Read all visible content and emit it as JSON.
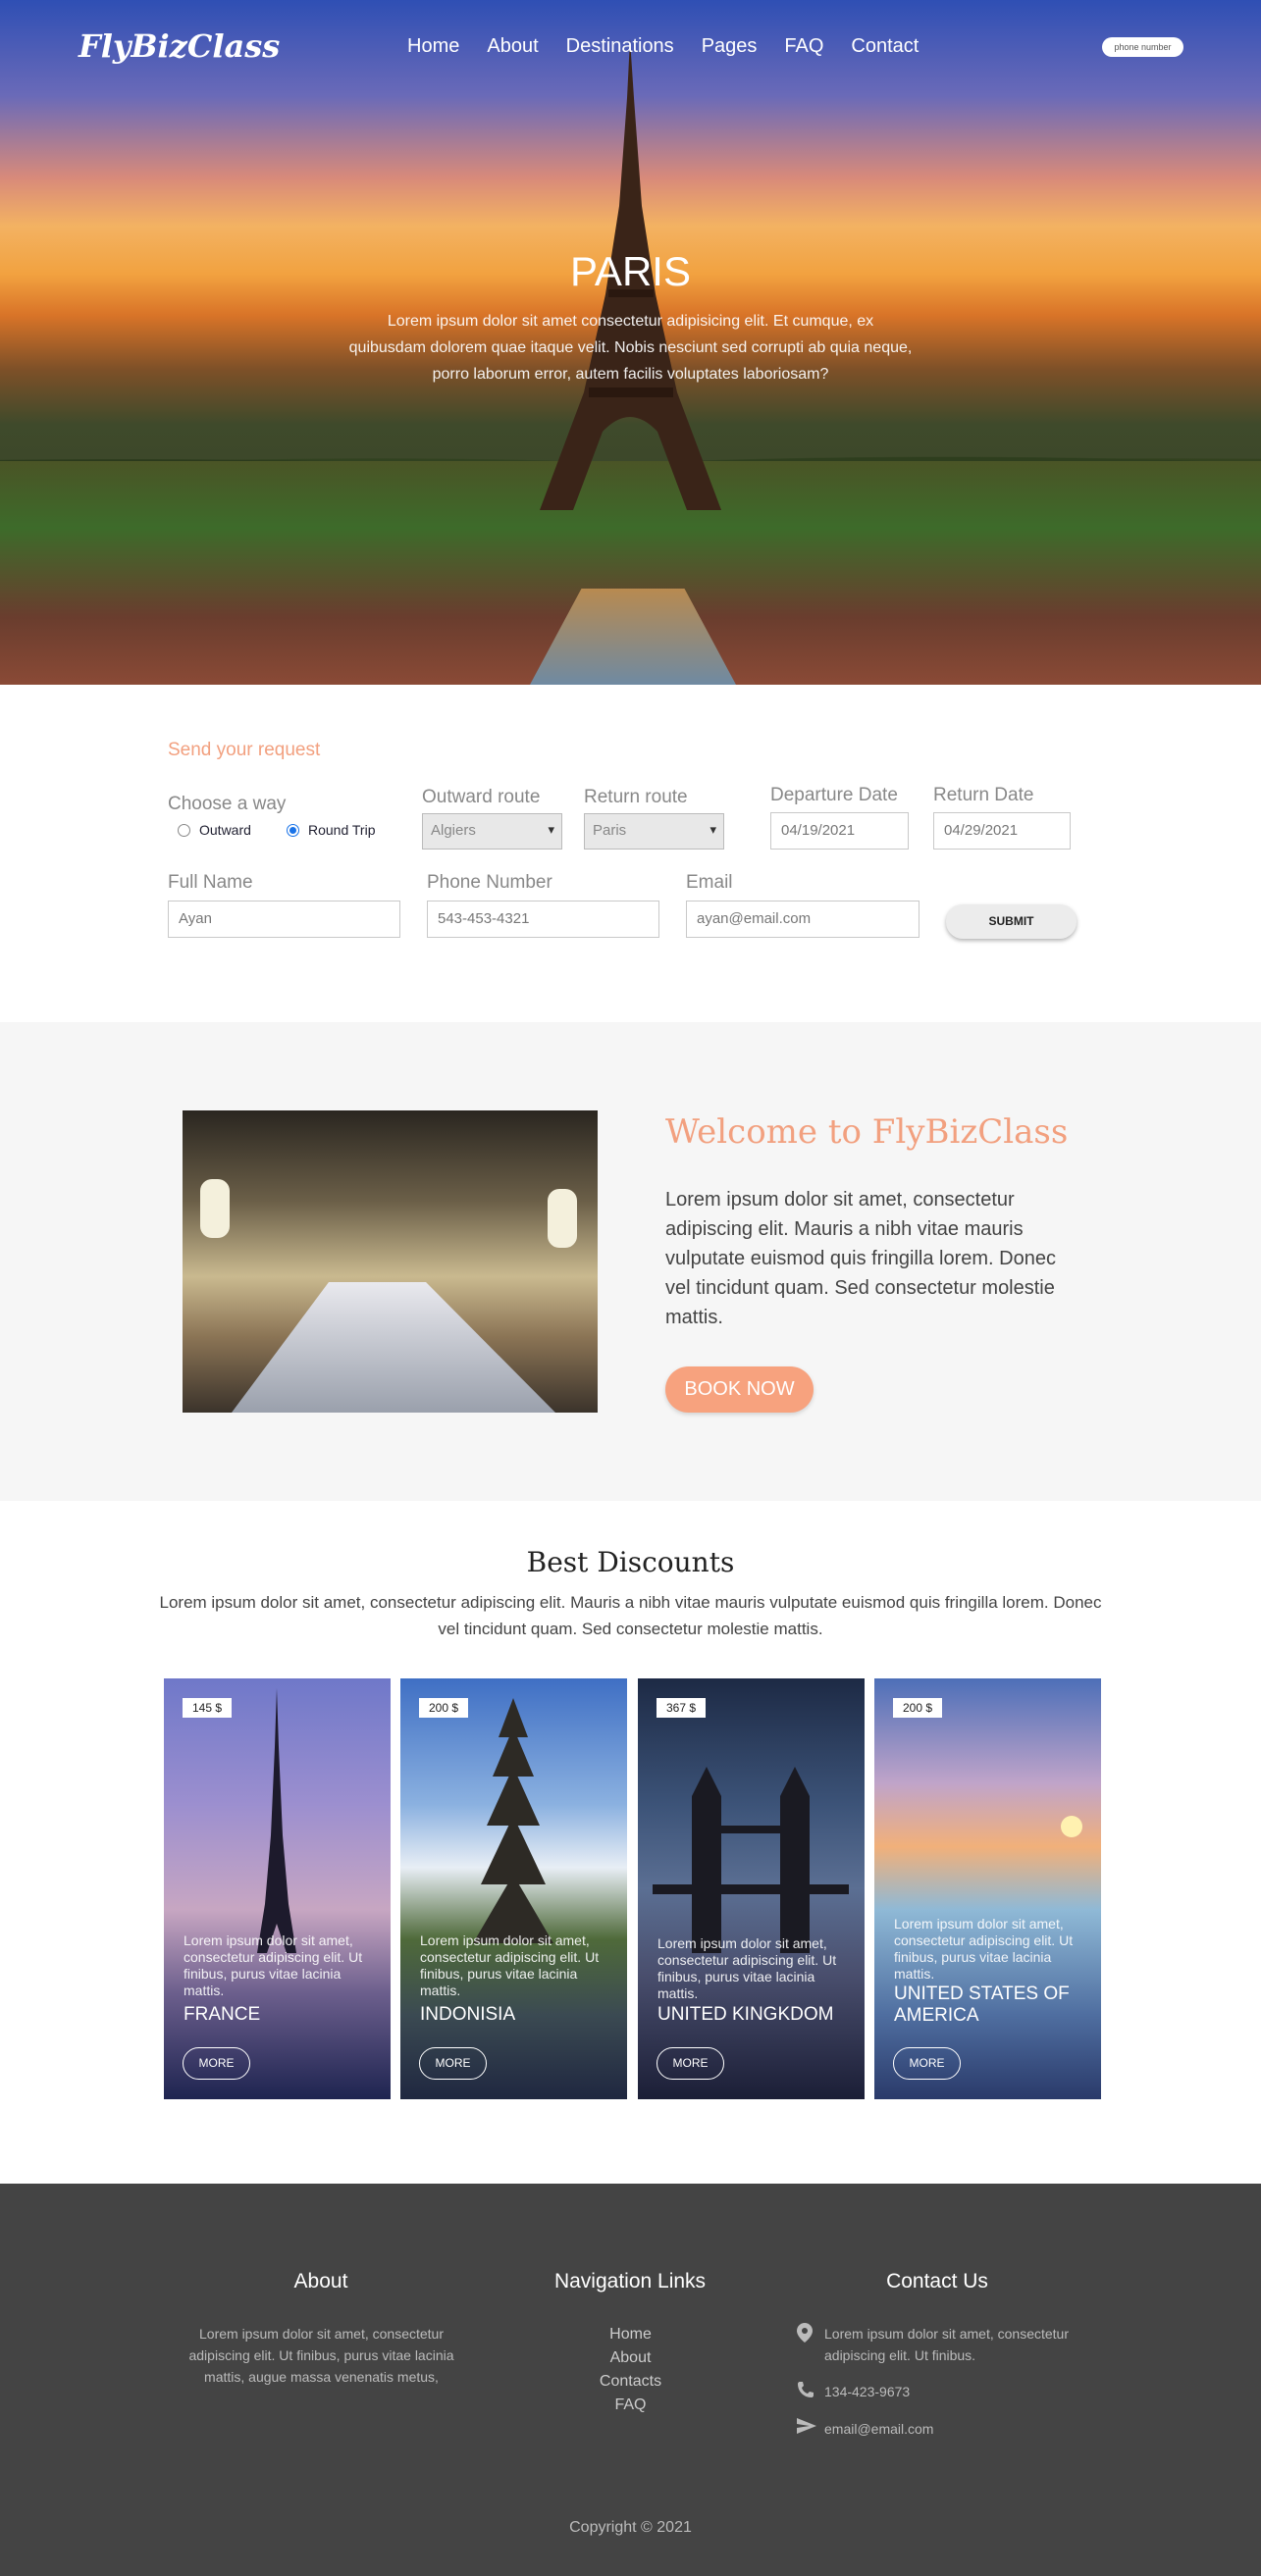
{
  "header": {
    "logo": "FlyBizClass",
    "nav": [
      "Home",
      "About",
      "Destinations",
      "Pages",
      "FAQ",
      "Contact"
    ],
    "phone_label": "phone number"
  },
  "hero": {
    "title": "PARIS",
    "text": "Lorem ipsum dolor sit amet consectetur adipisicing elit. Et cumque, ex quibusdam dolorem quae itaque velit. Nobis nesciunt sed corrupti ab quia neque, porro laborum error, autem facilis voluptates laboriosam?"
  },
  "request_form": {
    "title": "Send your request",
    "choose_way_label": "Choose a way",
    "options": [
      "Outward",
      "Round Trip"
    ],
    "selected_option": "Round Trip",
    "outward_route_label": "Outward route",
    "outward_route_value": "Algiers",
    "return_route_label": "Return route",
    "return_route_value": "Paris",
    "departure_date_label": "Departure Date",
    "departure_date_value": "04/19/2021",
    "return_date_label": "Return Date",
    "return_date_value": "04/29/2021",
    "full_name_label": "Full Name",
    "full_name_value": "Ayan",
    "phone_label": "Phone Number",
    "phone_value": "543-453-4321",
    "email_label": "Email",
    "email_value": "ayan@email.com",
    "submit_label": "SUBMIT"
  },
  "welcome": {
    "title": "Welcome to FlyBizClass",
    "text": "Lorem ipsum dolor sit amet, consectetur adipiscing elit. Mauris a nibh vitae mauris vulputate euismod quis fringilla lorem. Donec vel tincidunt quam. Sed consectetur molestie mattis.",
    "button": "BOOK NOW"
  },
  "discounts": {
    "title": "Best Discounts",
    "text": "Lorem ipsum dolor sit amet, consectetur adipiscing elit. Mauris a nibh vitae mauris vulputate euismod quis fringilla lorem. Donec vel tincidunt quam. Sed consectetur molestie mattis.",
    "cards": [
      {
        "price": "145 $",
        "text": "Lorem ipsum dolor sit amet, consectetur adipiscing elit. Ut finibus, purus vitae lacinia mattis.",
        "name": "FRANCE",
        "more": "MORE"
      },
      {
        "price": "200 $",
        "text": "Lorem ipsum dolor sit amet, consectetur adipiscing elit. Ut finibus, purus vitae lacinia mattis.",
        "name": "INDONISIA",
        "more": "MORE"
      },
      {
        "price": "367 $",
        "text": "Lorem ipsum dolor sit amet, consectetur adipiscing elit. Ut finibus, purus vitae lacinia mattis.",
        "name": "UNITED KINGKDOM",
        "more": "MORE"
      },
      {
        "price": "200 $",
        "text": "Lorem ipsum dolor sit amet, consectetur adipiscing elit. Ut finibus, purus vitae lacinia mattis.",
        "name": "UNITED STATES OF AMERICA",
        "more": "MORE"
      }
    ]
  },
  "footer": {
    "about_title": "About",
    "about_text": "Lorem ipsum dolor sit amet, consectetur adipiscing elit. Ut finibus, purus vitae lacinia mattis, augue massa venenatis metus,",
    "nav_title": "Navigation Links",
    "nav_links": [
      "Home",
      "About",
      "Contacts",
      "FAQ"
    ],
    "contact_title": "Contact Us",
    "address": "Lorem ipsum dolor sit amet, consectetur adipiscing elit. Ut finibus.",
    "phone": "134-423-9673",
    "email": "email@email.com",
    "copyright": "Copyright © 2021"
  },
  "colors": {
    "accent": "#f7a27e",
    "footer_bg": "#444444",
    "welcome_bg": "#f6f6f6"
  },
  "icons": [
    "location-pin-icon",
    "phone-icon",
    "send-icon"
  ]
}
